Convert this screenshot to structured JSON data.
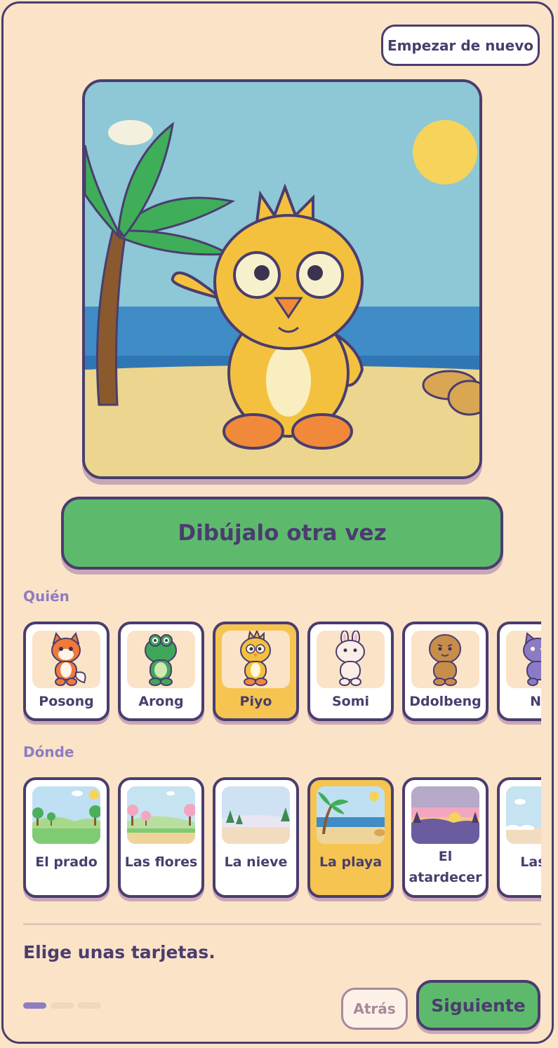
{
  "header": {
    "restart_label": "Empezar de nuevo"
  },
  "scene": {
    "character": "Piyo",
    "place": "La playa"
  },
  "redraw_label": "Dibújalo otra vez",
  "who": {
    "label": "Quién",
    "cards": [
      {
        "name": "Posong",
        "icon": "fox-icon",
        "color": "#f07a3a",
        "selected": false
      },
      {
        "name": "Arong",
        "icon": "frog-icon",
        "color": "#3fa75a",
        "selected": false
      },
      {
        "name": "Piyo",
        "icon": "chick-icon",
        "color": "#f4c13d",
        "selected": true
      },
      {
        "name": "Somi",
        "icon": "bunny-icon",
        "color": "#fbeee6",
        "selected": false
      },
      {
        "name": "Ddolbeng",
        "icon": "bear-icon",
        "color": "#c98d4a",
        "selected": false
      },
      {
        "name": "Na",
        "icon": "cat-icon",
        "color": "#8b7bc4",
        "selected": false
      }
    ]
  },
  "where": {
    "label": "Dónde",
    "cards": [
      {
        "name": "El prado",
        "icon": "meadow-icon",
        "selected": false
      },
      {
        "name": "Las flores",
        "icon": "flowers-icon",
        "selected": false
      },
      {
        "name": "La nieve",
        "icon": "snow-icon",
        "selected": false
      },
      {
        "name": "La playa",
        "icon": "beach-icon",
        "selected": true
      },
      {
        "name": "El\natardecer",
        "icon": "sunset-icon",
        "selected": false
      },
      {
        "name": "Las n",
        "icon": "clouds-icon",
        "selected": false
      }
    ]
  },
  "footer": {
    "prompt": "Elige unas tarjetas.",
    "back_label": "Atrás",
    "next_label": "Siguiente",
    "step": 1,
    "steps": 3
  },
  "colors": {
    "background": "#fbe3c8",
    "ink": "#4a3d6e",
    "accent_green": "#5dba6d",
    "selected_yellow": "#f6c450",
    "section_purple": "#8d7dc1"
  }
}
